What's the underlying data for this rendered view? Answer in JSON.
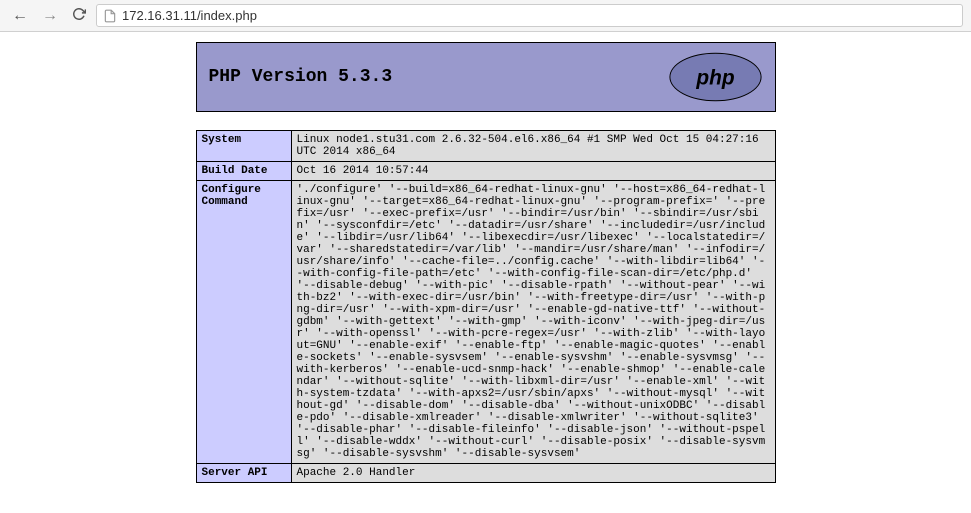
{
  "browser": {
    "url": "172.16.31.11/index.php"
  },
  "header": {
    "title": "PHP Version 5.3.3"
  },
  "rows": [
    {
      "label": "System",
      "value": "Linux node1.stu31.com 2.6.32-504.el6.x86_64 #1 SMP Wed Oct 15 04:27:16 UTC 2014 x86_64"
    },
    {
      "label": "Build Date",
      "value": "Oct 16 2014 10:57:44"
    },
    {
      "label": "Configure Command",
      "value": "'./configure' '--build=x86_64-redhat-linux-gnu' '--host=x86_64-redhat-linux-gnu' '--target=x86_64-redhat-linux-gnu' '--program-prefix=' '--prefix=/usr' '--exec-prefix=/usr' '--bindir=/usr/bin' '--sbindir=/usr/sbin' '--sysconfdir=/etc' '--datadir=/usr/share' '--includedir=/usr/include' '--libdir=/usr/lib64' '--libexecdir=/usr/libexec' '--localstatedir=/var' '--sharedstatedir=/var/lib' '--mandir=/usr/share/man' '--infodir=/usr/share/info' '--cache-file=../config.cache' '--with-libdir=lib64' '--with-config-file-path=/etc' '--with-config-file-scan-dir=/etc/php.d' '--disable-debug' '--with-pic' '--disable-rpath' '--without-pear' '--with-bz2' '--with-exec-dir=/usr/bin' '--with-freetype-dir=/usr' '--with-png-dir=/usr' '--with-xpm-dir=/usr' '--enable-gd-native-ttf' '--without-gdbm' '--with-gettext' '--with-gmp' '--with-iconv' '--with-jpeg-dir=/usr' '--with-openssl' '--with-pcre-regex=/usr' '--with-zlib' '--with-layout=GNU' '--enable-exif' '--enable-ftp' '--enable-magic-quotes' '--enable-sockets' '--enable-sysvsem' '--enable-sysvshm' '--enable-sysvmsg' '--with-kerberos' '--enable-ucd-snmp-hack' '--enable-shmop' '--enable-calendar' '--without-sqlite' '--with-libxml-dir=/usr' '--enable-xml' '--with-system-tzdata' '--with-apxs2=/usr/sbin/apxs' '--without-mysql' '--without-gd' '--disable-dom' '--disable-dba' '--without-unixODBC' '--disable-pdo' '--disable-xmlreader' '--disable-xmlwriter' '--without-sqlite3' '--disable-phar' '--disable-fileinfo' '--disable-json' '--without-pspell' '--disable-wddx' '--without-curl' '--disable-posix' '--disable-sysvmsg' '--disable-sysvshm' '--disable-sysvsem'"
    },
    {
      "label": "Server API",
      "value": "Apache 2.0 Handler"
    }
  ]
}
